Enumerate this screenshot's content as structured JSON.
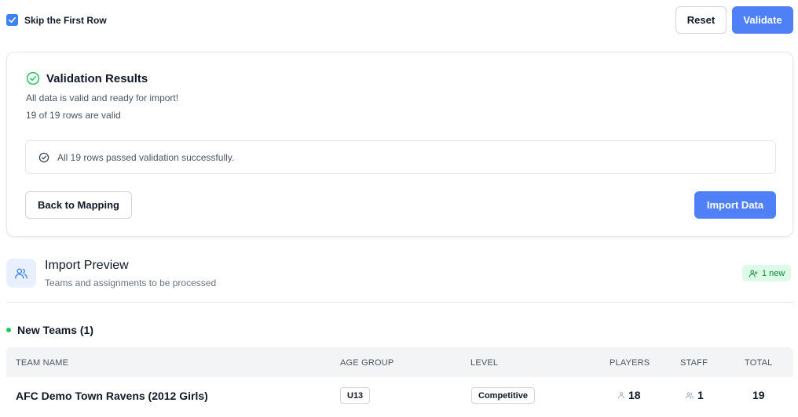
{
  "toolbar": {
    "skip_label": "Skip the First Row",
    "skip_checked": true,
    "reset_label": "Reset",
    "validate_label": "Validate"
  },
  "validation": {
    "title": "Validation Results",
    "message": "All data is valid and ready for import!",
    "summary": "19 of 19 rows are valid",
    "passed_text": "All 19 rows passed validation successfully.",
    "back_label": "Back to Mapping",
    "import_label": "Import Data"
  },
  "preview": {
    "title": "Import Preview",
    "subtitle": "Teams and assignments to be processed",
    "badge": "1 new"
  },
  "new_teams": {
    "label": "New Teams (1)",
    "columns": {
      "team_name": "TEAM NAME",
      "age_group": "AGE GROUP",
      "level": "LEVEL",
      "players": "PLAYERS",
      "staff": "STAFF",
      "total": "TOTAL"
    },
    "rows": [
      {
        "team_name": "AFC Demo Town Ravens (2012 Girls)",
        "age_group": "U13",
        "level": "Competitive",
        "players": "18",
        "staff": "1",
        "total": "19"
      }
    ]
  },
  "colors": {
    "primary": "#4f80f7",
    "success": "#22c55e",
    "badge_bg": "#dcfce7"
  },
  "icons": {
    "checkbox": "checkmark",
    "results": "circle-check-icon",
    "passed": "circle-check-icon",
    "preview": "users-icon",
    "badge": "user-plus-icon",
    "players": "user-icon",
    "staff": "users-icon"
  }
}
